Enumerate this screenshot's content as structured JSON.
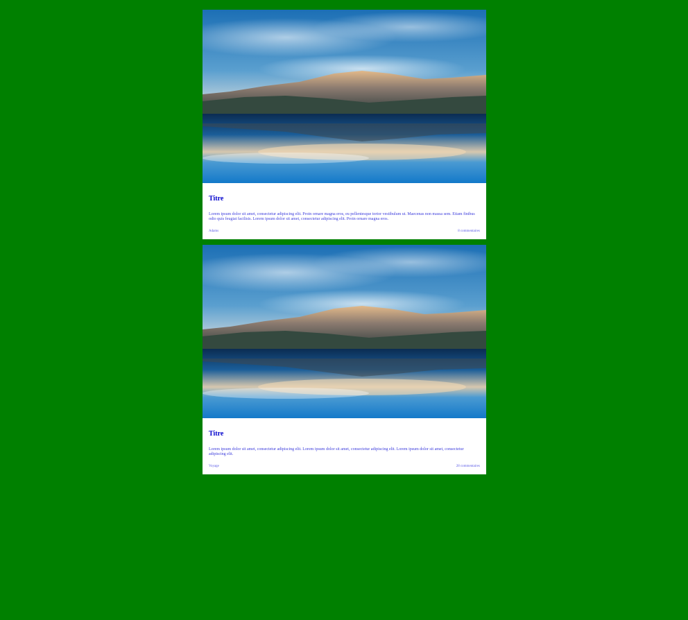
{
  "cards": [
    {
      "image_alt": "mountain-lake-landscape",
      "title": "Titre",
      "text": "Lorem ipsum dolor sit amet, consectetur adipiscing elit. Proin ornare magna eros, eu pellentesque tortor vestibulum ut. Maecenas non massa sem. Etiam finibus odio quis feugiat facilisis. Lorem ipsum dolor sit amet, consectetur adipiscing elit. Proin ornare magna eros.",
      "category": "Adams",
      "comments": "8 commentaires"
    },
    {
      "image_alt": "mountain-lake-landscape",
      "title": "Titre",
      "text": "Lorem ipsum dolor sit amet, consectetur adipiscing elit. Lorem ipsum dolor sit amet, consectetur adipiscing elit. Lorem ipsum dolor sit amet, consectetur adipiscing elit.",
      "category": "Voyage",
      "comments": "28 commentaires"
    }
  ],
  "colors": {
    "background": "#008000",
    "card": "#ffffff",
    "title": "#0000cc",
    "text": "#3b3bdc"
  }
}
